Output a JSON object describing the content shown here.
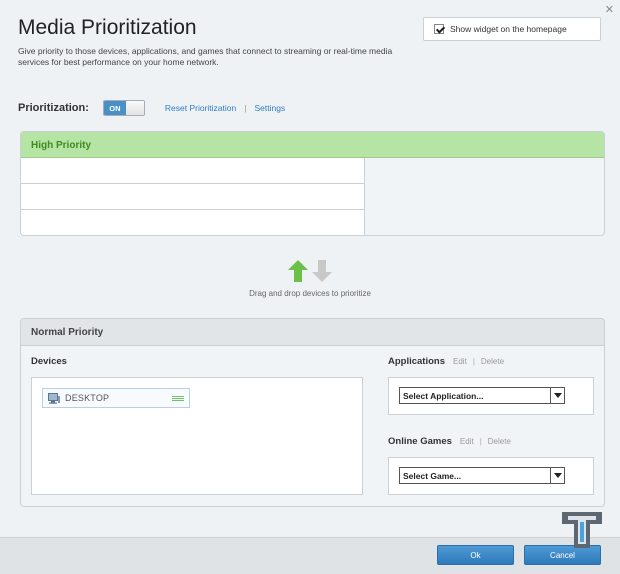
{
  "window": {
    "title": "Media Prioritization",
    "close_icon": "✕"
  },
  "description": "Give priority to those devices, applications, and games that connect to streaming or real-time media services for best performance on your home network.",
  "widget": {
    "label": "Show widget on the homepage",
    "checked": true
  },
  "prioritization": {
    "label": "Prioritization:",
    "toggle_state": "ON",
    "reset_link": "Reset Prioritization",
    "separator": "|",
    "settings_link": "Settings"
  },
  "high_priority": {
    "title": "High Priority"
  },
  "drag_hint": "Drag and drop devices to prioritize",
  "normal_priority": {
    "title": "Normal Priority",
    "devices_label": "Devices",
    "devices": [
      {
        "name": "DESKTOP",
        "icon": "computer-icon"
      }
    ],
    "applications": {
      "label": "Applications",
      "edit": "Edit",
      "separator": "|",
      "delete": "Delete",
      "select_value": "Select Application..."
    },
    "games": {
      "label": "Online Games",
      "edit": "Edit",
      "separator": "|",
      "delete": "Delete",
      "select_value": "Select Game..."
    }
  },
  "buttons": {
    "ok": "Ok",
    "cancel": "Cancel"
  },
  "colors": {
    "accent": "#2f7ec0",
    "high_priority_header": "#b5e4a4",
    "arrow_up": "#6cc04a",
    "arrow_down": "#c8c8c8"
  }
}
